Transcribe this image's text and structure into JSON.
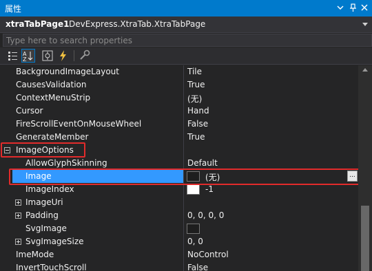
{
  "window": {
    "title": "属性",
    "controls": [
      "chevron-down-icon",
      "pin-icon",
      "close-icon"
    ]
  },
  "object_selector": {
    "name": "xtraTabPage1",
    "type": "DevExpress.XtraTab.XtraTabPage"
  },
  "search": {
    "placeholder": "Type here to search properties",
    "value": ""
  },
  "toolbar": {
    "buttons": [
      "categorized-icon",
      "alphabetical-icon",
      "properties-icon",
      "events-icon",
      "property-pages-icon"
    ],
    "active": "alphabetical-icon"
  },
  "properties": [
    {
      "name": "BackgroundImageLayout",
      "value": "Tile"
    },
    {
      "name": "CausesValidation",
      "value": "True"
    },
    {
      "name": "ContextMenuStrip",
      "value": "(无)"
    },
    {
      "name": "Cursor",
      "value": "Hand"
    },
    {
      "name": "FireScrollEventOnMouseWheel",
      "value": "False"
    },
    {
      "name": "GenerateMember",
      "value": "True"
    },
    {
      "name": "ImageOptions",
      "value": ""
    },
    {
      "name": "AllowGlyphSkinning",
      "value": "Default"
    },
    {
      "name": "Image",
      "value": "(无)"
    },
    {
      "name": "ImageIndex",
      "value": "-1"
    },
    {
      "name": "ImageUri",
      "value": ""
    },
    {
      "name": "Padding",
      "value": "0, 0, 0, 0"
    },
    {
      "name": "SvgImage",
      "value": ""
    },
    {
      "name": "SvgImageSize",
      "value": "0, 0"
    },
    {
      "name": "ImeMode",
      "value": "NoControl"
    },
    {
      "name": "InvertTouchScroll",
      "value": "False"
    }
  ],
  "ellipsis_label": "...",
  "colors": {
    "accent": "#007acc",
    "selection": "#3399ff",
    "highlight_box": "#e32b2b"
  }
}
